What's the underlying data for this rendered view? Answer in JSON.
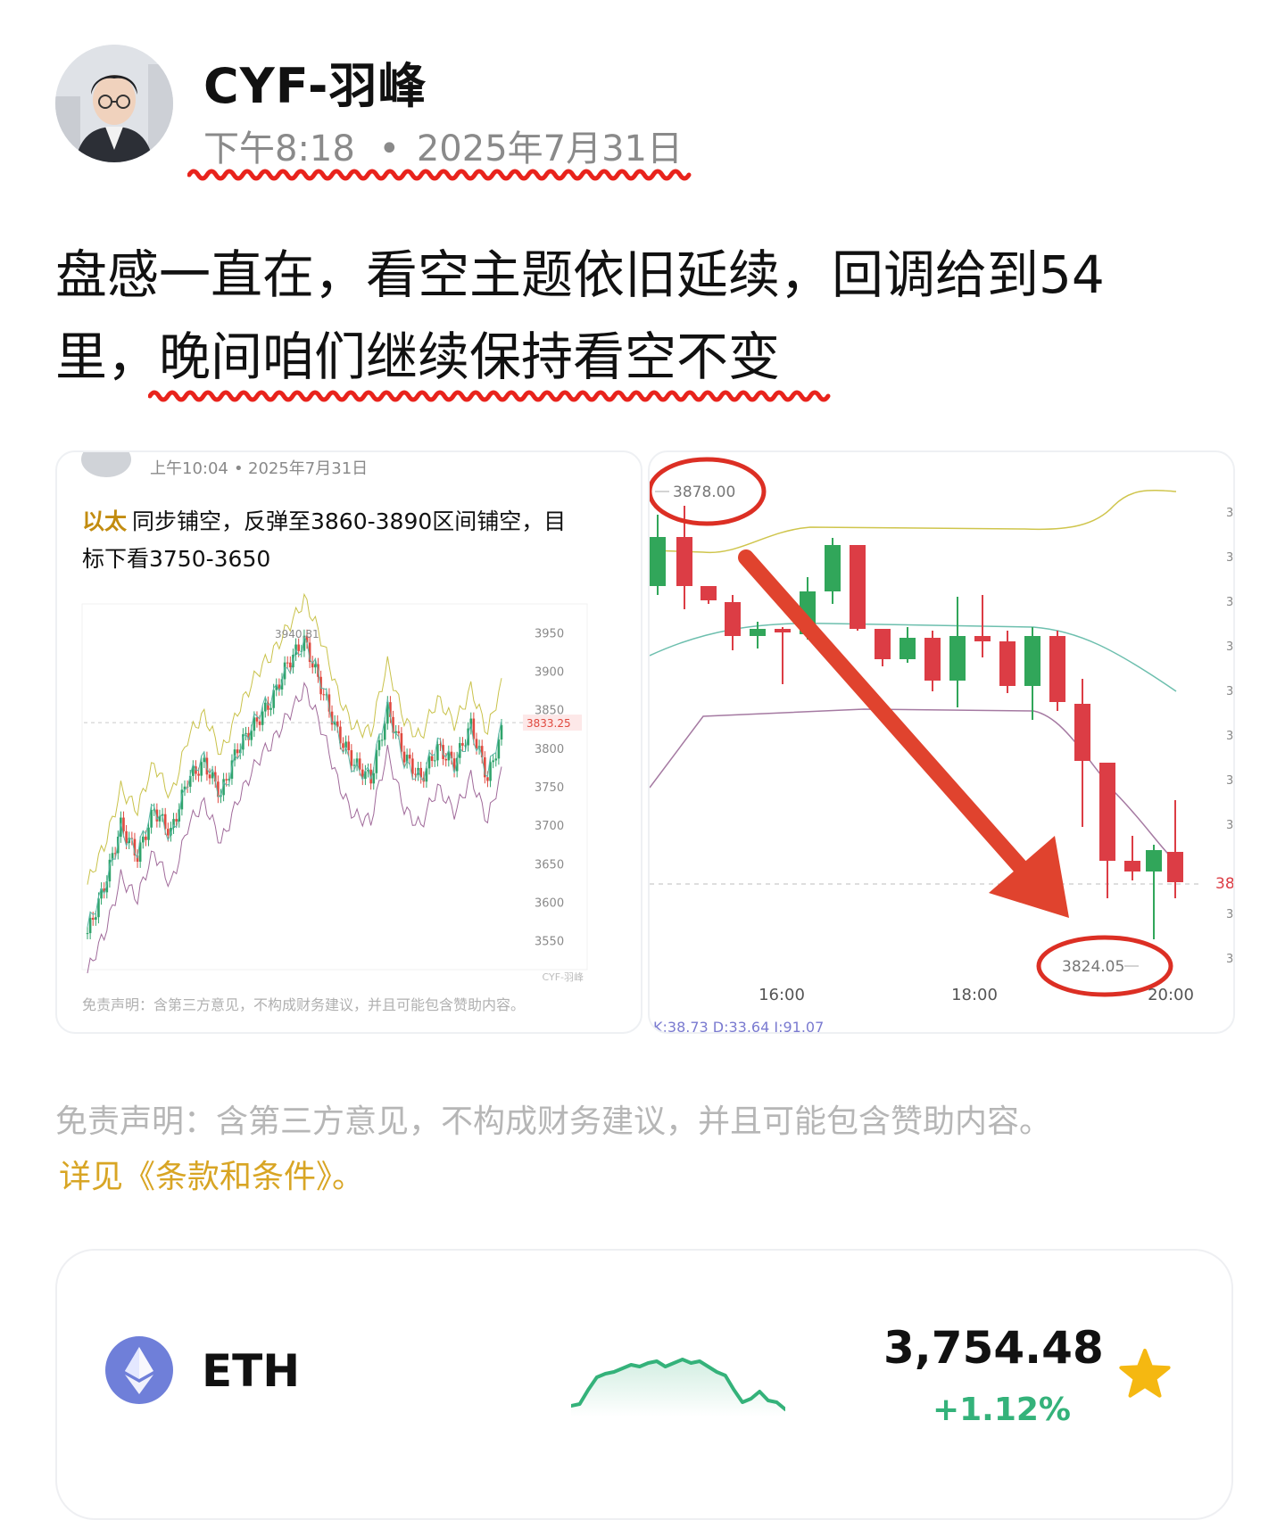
{
  "header": {
    "author": "CYF-羽峰",
    "time": "下午8:18",
    "separator": "•",
    "date": "2025年7月31日"
  },
  "post": {
    "line1": "盘感一直在，看空主题依旧延续，回调给到54",
    "line2_prefix": "里，",
    "line2_highlight": "晚间咱们继续保持看空不变"
  },
  "left_card": {
    "time": "上午10:04",
    "separator": "•",
    "date": "2025年7月31日",
    "highlight": "以太",
    "text_line1": "同步铺空，反弹至3860-3890区间铺空，目",
    "text_line2": "标下看3750-3650",
    "disclaimer": "免责声明：含第三方意见，不构成财务建议，并且可能包含赞助内容。",
    "watermark": "CYF-羽峰",
    "chart_data": {
      "type": "line",
      "yticks": [
        3950,
        3900,
        3850,
        3800,
        3750,
        3700,
        3650,
        3600,
        3550
      ],
      "high_label": "3940.81",
      "current_price_label": "3833.25",
      "ylim": [
        3530,
        3970
      ]
    }
  },
  "right_card": {
    "chart_data": {
      "type": "bar",
      "x_ticks": [
        "16:00",
        "18:00",
        "20:00"
      ],
      "high_label": "3878.00",
      "low_label": "3824.05",
      "right_edge_label": "38",
      "indicator_text": "K:38.73 D:33.64 J:91.07"
    }
  },
  "footer": {
    "disclaimer": "免责声明：含第三方意见，不构成财务建议，并且可能包含赞助内容。",
    "terms": "详见《条款和条件》。"
  },
  "ticker": {
    "symbol": "ETH",
    "price": "3,754.48",
    "change": "+1.12%",
    "icon": "eth-icon",
    "favorite_icon": "star-icon",
    "accent": "#34b27a",
    "star_color": "#f5b811"
  }
}
